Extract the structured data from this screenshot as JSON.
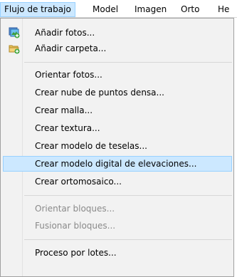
{
  "menubar": {
    "items": [
      {
        "label": "Flujo de trabajo"
      },
      {
        "label": "Model"
      },
      {
        "label": "Imagen"
      },
      {
        "label": "Orto"
      },
      {
        "label": "He"
      }
    ]
  },
  "menu": {
    "items": [
      {
        "label": "Añadir fotos...",
        "icon": "add-photos-icon"
      },
      {
        "label": "Añadir carpeta...",
        "icon": "add-folder-icon"
      },
      {
        "label": "Orientar fotos..."
      },
      {
        "label": "Crear nube de puntos densa..."
      },
      {
        "label": "Crear malla..."
      },
      {
        "label": "Crear textura..."
      },
      {
        "label": "Crear modelo de teselas..."
      },
      {
        "label": "Crear modelo digital de elevaciones...",
        "highlighted": true
      },
      {
        "label": "Crear ortomosaico..."
      },
      {
        "label": "Orientar bloques...",
        "disabled": true
      },
      {
        "label": "Fusionar bloques...",
        "disabled": true
      },
      {
        "label": "Proceso por lotes..."
      }
    ]
  },
  "colors": {
    "highlight": "#cce8ff",
    "highlight_border": "#99d1ff",
    "menu_background": "#f2f2f2",
    "disabled_text": "#8a8a8a"
  }
}
